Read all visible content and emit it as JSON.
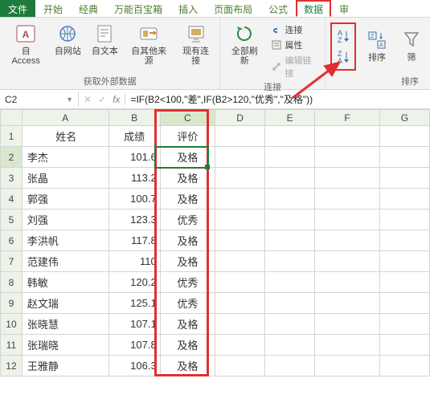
{
  "tabs": {
    "file": "文件",
    "start": "开始",
    "classic": "经典",
    "toolbox": "万能百宝箱",
    "insert": "插入",
    "layout": "页面布局",
    "formulas": "公式",
    "data": "数据",
    "review": "审"
  },
  "ribbon": {
    "ext_group_label": "获取外部数据",
    "access": "自 Access",
    "web": "自网站",
    "text": "自文本",
    "other": "自其他来源",
    "existing": "现有连接",
    "refresh": "全部刷新",
    "conn": "连接",
    "props": "属性",
    "editlinks": "编辑链接",
    "conn_group_label": "连接",
    "sort": "排序",
    "sort_group_label": "排序",
    "filter": "筛"
  },
  "namebox": "C2",
  "formula": "=IF(B2<100,\"差\",IF(B2>120,\"优秀\",\"及格\"))",
  "cols": [
    "A",
    "B",
    "C",
    "D",
    "E",
    "F",
    "G"
  ],
  "chart_data": {
    "type": "table",
    "title": "",
    "columns": [
      "姓名",
      "成绩",
      "评价"
    ],
    "rows": [
      {
        "name": "李杰",
        "score": 101.6,
        "eval": "及格"
      },
      {
        "name": "张晶",
        "score": 113.2,
        "eval": "及格"
      },
      {
        "name": "郭强",
        "score": 100.7,
        "eval": "及格"
      },
      {
        "name": "刘强",
        "score": 123.3,
        "eval": "优秀"
      },
      {
        "name": "李洪帆",
        "score": 117.8,
        "eval": "及格"
      },
      {
        "name": "范建伟",
        "score": 110,
        "eval": "及格"
      },
      {
        "name": "韩敏",
        "score": 120.2,
        "eval": "优秀"
      },
      {
        "name": "赵文瑞",
        "score": 125.1,
        "eval": "优秀"
      },
      {
        "name": "张晓慧",
        "score": 107.1,
        "eval": "及格"
      },
      {
        "name": "张瑞晓",
        "score": 107.8,
        "eval": "及格"
      },
      {
        "name": "王雅静",
        "score": 106.3,
        "eval": "及格"
      }
    ]
  },
  "colors": {
    "accent": "#1e7b3c",
    "annotation": "#e03030"
  }
}
